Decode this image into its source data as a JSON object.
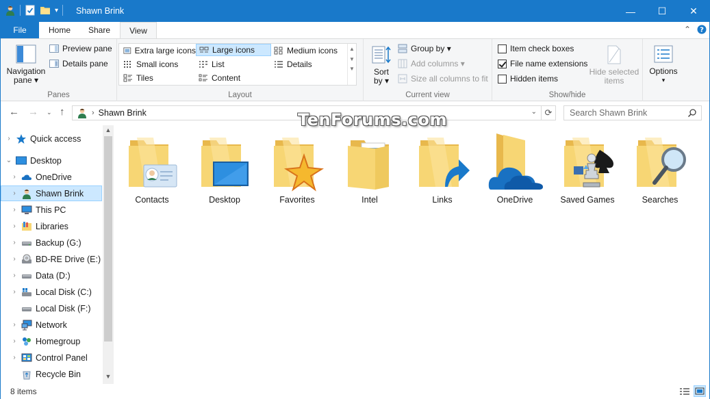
{
  "window": {
    "title": "Shawn Brink",
    "minimize": "—",
    "maximize": "☐",
    "close": "✕"
  },
  "colors": {
    "accent": "#1979ca",
    "selection": "#cce8ff",
    "folder": "#f7d674"
  },
  "tabs": [
    {
      "label": "File"
    },
    {
      "label": "Home"
    },
    {
      "label": "Share"
    },
    {
      "label": "View"
    }
  ],
  "ribbon": {
    "panes": {
      "navigation_pane": "Navigation",
      "navigation_pane_2": "pane ▾",
      "preview_pane": "Preview pane",
      "details_pane": "Details pane",
      "label": "Panes"
    },
    "layout": {
      "label": "Layout",
      "options": [
        {
          "label": "Extra large icons"
        },
        {
          "label": "Large icons"
        },
        {
          "label": "Medium icons"
        },
        {
          "label": "Small icons"
        },
        {
          "label": "List"
        },
        {
          "label": "Details"
        },
        {
          "label": "Tiles"
        },
        {
          "label": "Content"
        }
      ],
      "selected": "Large icons"
    },
    "current_view": {
      "label": "Current view",
      "sort_by": "Sort",
      "sort_by_2": "by ▾",
      "group_by": "Group by ▾",
      "add_columns": "Add columns ▾",
      "size_columns": "Size all columns to fit"
    },
    "show_hide": {
      "label": "Show/hide",
      "item_check_boxes": "Item check boxes",
      "file_name_extensions": "File name extensions",
      "hidden_items": "Hidden items",
      "hide_selected": "Hide selected",
      "hide_selected_2": "items"
    },
    "options": {
      "label": "Options",
      "arrow": "▾"
    }
  },
  "address": {
    "path": "Shawn Brink",
    "search_placeholder": "Search Shawn Brink",
    "watermark": "TenForums.com"
  },
  "nav_pane": {
    "items": [
      {
        "label": "Quick access",
        "icon": "star-icon"
      },
      {
        "label": "Desktop",
        "icon": "desktop-icon"
      },
      {
        "label": "OneDrive",
        "icon": "cloud-icon"
      },
      {
        "label": "Shawn Brink",
        "icon": "user-icon"
      },
      {
        "label": "This PC",
        "icon": "computer-icon"
      },
      {
        "label": "Libraries",
        "icon": "library-icon"
      },
      {
        "label": "Backup (G:)",
        "icon": "drive-icon"
      },
      {
        "label": "BD-RE Drive (E:)",
        "icon": "disc-drive-icon"
      },
      {
        "label": "Data (D:)",
        "icon": "drive-icon"
      },
      {
        "label": "Local Disk (C:)",
        "icon": "windows-drive-icon"
      },
      {
        "label": "Local Disk (F:)",
        "icon": "drive-icon"
      },
      {
        "label": "Network",
        "icon": "network-icon"
      },
      {
        "label": "Homegroup",
        "icon": "homegroup-icon"
      },
      {
        "label": "Control Panel",
        "icon": "control-panel-icon"
      },
      {
        "label": "Recycle Bin",
        "icon": "recycle-bin-icon"
      }
    ]
  },
  "folders": [
    {
      "name": "Contacts",
      "icon": "contacts-folder-icon"
    },
    {
      "name": "Desktop",
      "icon": "desktop-folder-icon"
    },
    {
      "name": "Favorites",
      "icon": "favorites-folder-icon"
    },
    {
      "name": "Intel",
      "icon": "folder-icon"
    },
    {
      "name": "Links",
      "icon": "links-folder-icon"
    },
    {
      "name": "OneDrive",
      "icon": "onedrive-folder-icon"
    },
    {
      "name": "Saved Games",
      "icon": "saved-games-folder-icon"
    },
    {
      "name": "Searches",
      "icon": "searches-folder-icon"
    }
  ],
  "status": {
    "count": "8 items"
  }
}
